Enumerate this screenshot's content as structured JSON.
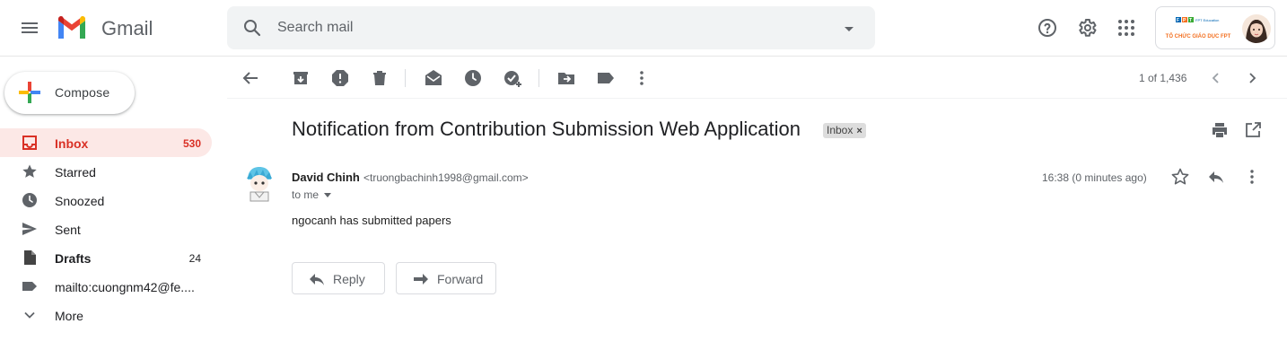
{
  "app": {
    "name": "Gmail"
  },
  "search": {
    "placeholder": "Search mail"
  },
  "header": {
    "org_name": "TỔ CHỨC GIÁO DỤC FPT",
    "org_logo_text": "FPT Education"
  },
  "compose": {
    "label": "Compose"
  },
  "sidebar": {
    "items": [
      {
        "label": "Inbox",
        "count": "530",
        "icon": "inbox-icon",
        "active": true
      },
      {
        "label": "Starred",
        "count": "",
        "icon": "star-icon"
      },
      {
        "label": "Snoozed",
        "count": "",
        "icon": "clock-icon"
      },
      {
        "label": "Sent",
        "count": "",
        "icon": "send-icon"
      },
      {
        "label": "Drafts",
        "count": "24",
        "icon": "draft-icon"
      },
      {
        "label": "mailto:cuongnm42@fe....",
        "count": "",
        "icon": "label-icon"
      },
      {
        "label": "More",
        "count": "",
        "icon": "chevron-down-icon"
      }
    ]
  },
  "toolbar": {
    "pager": "1 of 1,436"
  },
  "message": {
    "subject": "Notification from Contribution Submission Web Application",
    "label_chip": "Inbox",
    "label_chip_remove": "×",
    "sender_name": "David Chinh",
    "sender_email": "<truongbachinh1998@gmail.com>",
    "to": "to me",
    "time": "16:38 (0 minutes ago)",
    "body": "ngocanh has submitted papers"
  },
  "actions": {
    "reply": "Reply",
    "forward": "Forward"
  },
  "colors": {
    "accent": "#d93025",
    "active_bg": "#fce8e6",
    "text": "#202124",
    "muted": "#5f6368"
  }
}
